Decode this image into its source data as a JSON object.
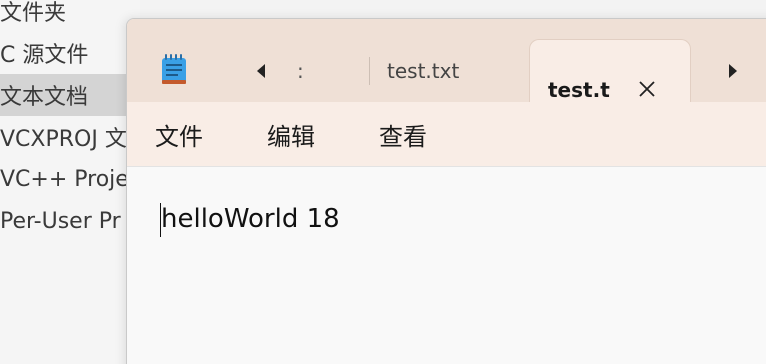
{
  "background_menu": {
    "items": [
      {
        "label": "文件夹",
        "highlighted": false
      },
      {
        "label": "C 源文件",
        "highlighted": false
      },
      {
        "label": "文本文档",
        "highlighted": true
      },
      {
        "label": "VCXPROJ 文",
        "highlighted": false
      },
      {
        "label": "VC++ Proje",
        "highlighted": false
      },
      {
        "label": "Per-User Pr",
        "highlighted": false
      }
    ]
  },
  "notepad": {
    "app_icon": "notepad-icon",
    "tabs": [
      {
        "label": ":",
        "state": "collapsed"
      },
      {
        "label": "test.txt",
        "state": "inactive"
      },
      {
        "label": "test.txt",
        "state": "active"
      }
    ],
    "nav_left_icon": "chevron-left-icon",
    "nav_right_icon": "chevron-right-icon",
    "close_icon": "close-icon",
    "menu": {
      "file": "文件",
      "edit": "编辑",
      "view": "查看"
    },
    "content": "helloWorld 18"
  },
  "colors": {
    "titlebar": "#efe0d6",
    "active_tab": "#f9ede6",
    "menubar": "#f9ede6",
    "editor_bg": "#f9f9f9",
    "context_highlight": "#d4d4d4"
  }
}
